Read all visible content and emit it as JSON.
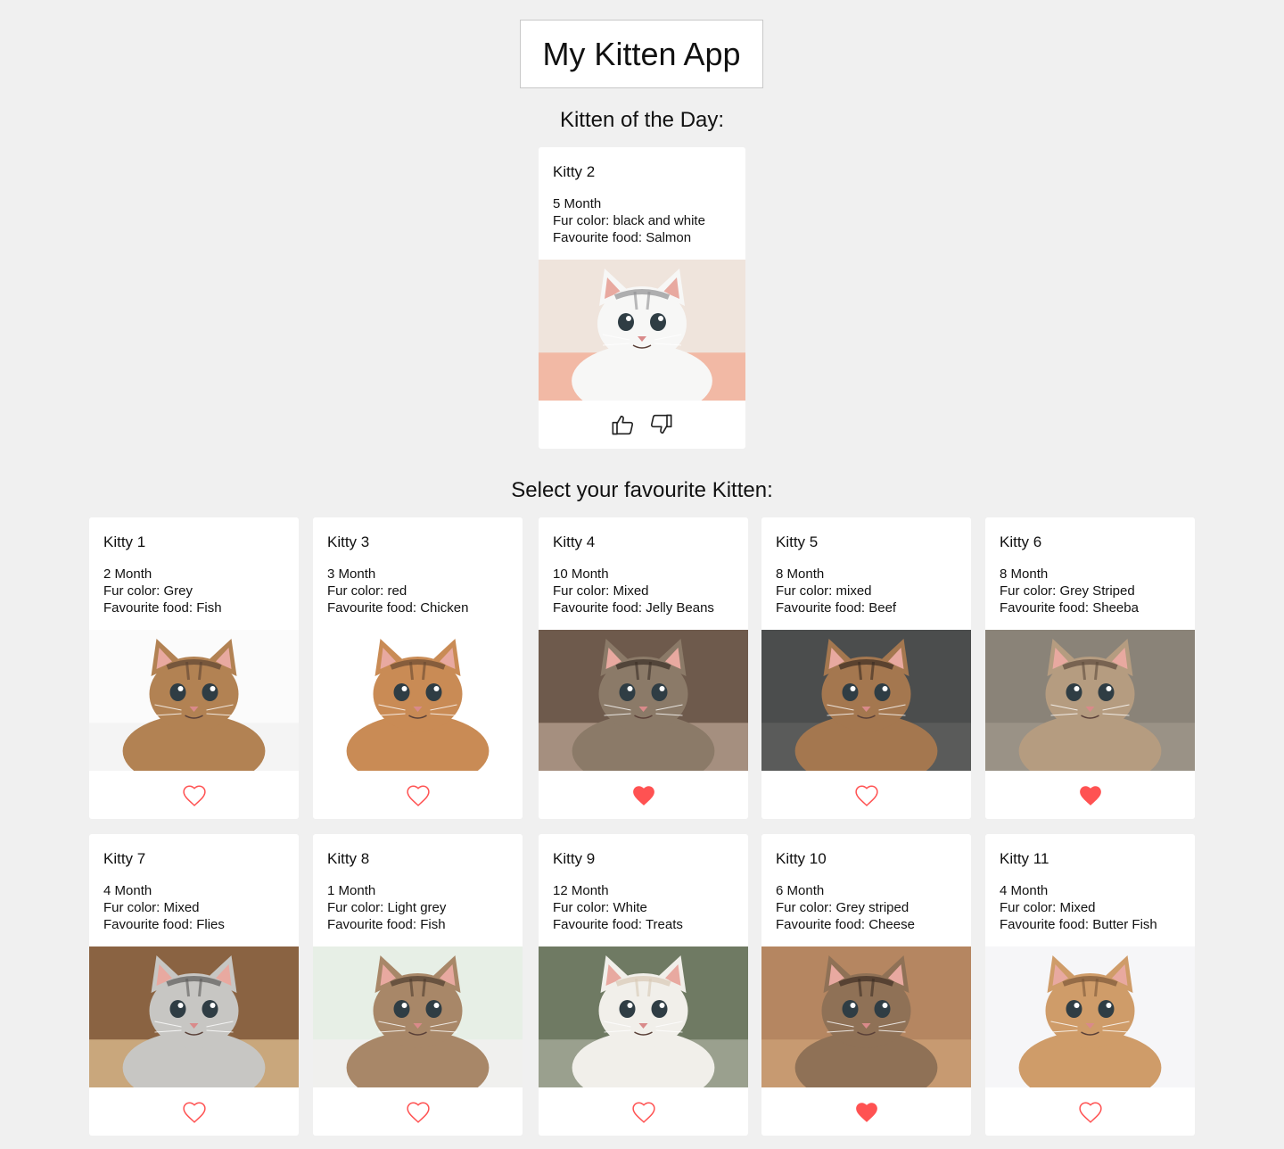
{
  "app": {
    "title": "My Kitten App"
  },
  "featured": {
    "heading": "Kitten of the Day:",
    "kitten": {
      "name": "Kitty 2",
      "age": "5 Month",
      "fur": "Fur color: black and white",
      "food": "Favourite food: Salmon",
      "palette": {
        "bg": "#efe4dc",
        "floor": "#f2b9a5",
        "body": "#f7f7f6",
        "patch": "#8f8f92"
      }
    },
    "actions": {
      "like_icon": "thumbs-up-icon",
      "dislike_icon": "thumbs-down-icon"
    }
  },
  "gallery": {
    "heading": "Select your favourite Kitten:",
    "kittens": [
      {
        "name": "Kitty 1",
        "age": "2 Month",
        "fur": "Fur color: Grey",
        "food": "Favourite food: Fish",
        "favourite": false,
        "palette": {
          "bg": "#fbfbfb",
          "floor": "#f4f4f4",
          "body": "#b28253",
          "patch": "#5e4433"
        }
      },
      {
        "name": "Kitty 3",
        "age": "3 Month",
        "fur": "Fur color: red",
        "food": "Favourite food: Chicken",
        "favourite": false,
        "palette": {
          "bg": "#ffffff",
          "floor": "#ffffff",
          "body": "#c98b55",
          "patch": "#6a4a32"
        }
      },
      {
        "name": "Kitty 4",
        "age": "10 Month",
        "fur": "Fur color: Mixed",
        "food": "Favourite food: Jelly Beans",
        "favourite": true,
        "palette": {
          "bg": "#6e5a4c",
          "floor": "#a58f7f",
          "body": "#8b7a68",
          "patch": "#3b2f26"
        }
      },
      {
        "name": "Kitty 5",
        "age": "8 Month",
        "fur": "Fur color: mixed",
        "food": "Favourite food: Beef",
        "favourite": false,
        "palette": {
          "bg": "#4b4d4d",
          "floor": "#5a5b5a",
          "body": "#a4774f",
          "patch": "#3a2c22"
        }
      },
      {
        "name": "Kitty 6",
        "age": "8 Month",
        "fur": "Fur color: Grey Striped",
        "food": "Favourite food: Sheeba",
        "favourite": true,
        "palette": {
          "bg": "#8a8378",
          "floor": "#9a9286",
          "body": "#b59c80",
          "patch": "#5e4c3d"
        }
      },
      {
        "name": "Kitty 7",
        "age": "4 Month",
        "fur": "Fur color: Mixed",
        "food": "Favourite food: Flies",
        "favourite": false,
        "palette": {
          "bg": "#8a6342",
          "floor": "#c9a77c",
          "body": "#c7c6c3",
          "patch": "#5c5b5a"
        }
      },
      {
        "name": "Kitty 8",
        "age": "1 Month",
        "fur": "Fur color: Light grey",
        "food": "Favourite food: Fish",
        "favourite": false,
        "palette": {
          "bg": "#e7efe6",
          "floor": "#f0f0ee",
          "body": "#a88768",
          "patch": "#4f3d2f"
        }
      },
      {
        "name": "Kitty 9",
        "age": "12 Month",
        "fur": "Fur color: White",
        "food": "Favourite food: Treats",
        "favourite": false,
        "palette": {
          "bg": "#6f7a63",
          "floor": "#9aa08e",
          "body": "#f1efea",
          "patch": "#d8c9b5"
        }
      },
      {
        "name": "Kitty 10",
        "age": "6 Month",
        "fur": "Fur color: Grey striped",
        "food": "Favourite food: Cheese",
        "favourite": true,
        "palette": {
          "bg": "#b58661",
          "floor": "#c79a71",
          "body": "#8f7156",
          "patch": "#3e2f25"
        }
      },
      {
        "name": "Kitty 11",
        "age": "4 Month",
        "fur": "Fur color: Mixed",
        "food": "Favourite food: Butter Fish",
        "favourite": false,
        "palette": {
          "bg": "#f6f6f8",
          "floor": "#f6f6f8",
          "body": "#cf9c69",
          "patch": "#7c5839"
        }
      }
    ]
  },
  "colors": {
    "heart": "#ff5252",
    "background": "#f0f0f0",
    "card": "#ffffff"
  },
  "icons": {
    "favourite": "heart-icon"
  }
}
